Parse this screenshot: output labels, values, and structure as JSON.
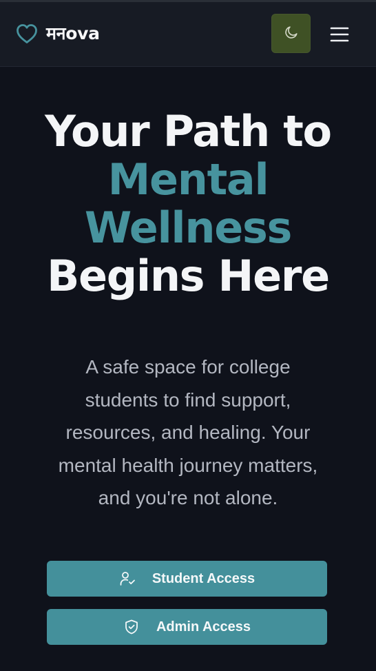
{
  "brand": {
    "name": "मनova",
    "icon": "heart-icon"
  },
  "navbar": {
    "theme_toggle_icon": "moon-icon",
    "menu_icon": "hamburger-menu-icon"
  },
  "hero": {
    "title_line_1": "Your Path to",
    "title_accent_line_1": "Mental",
    "title_accent_line_2": "Wellness",
    "title_line_2": "Begins Here",
    "description": "A safe space for college students to find support, resources, and healing. Your mental health journey matters, and you're not alone."
  },
  "actions": {
    "student_label": "Student Access",
    "student_icon": "user-check-icon",
    "admin_label": "Admin Access",
    "admin_icon": "shield-icon"
  },
  "colors": {
    "background": "#0f121b",
    "navbar": "#171b24",
    "accent": "#47939e",
    "button": "#44909b",
    "toggle": "#3f5125"
  }
}
